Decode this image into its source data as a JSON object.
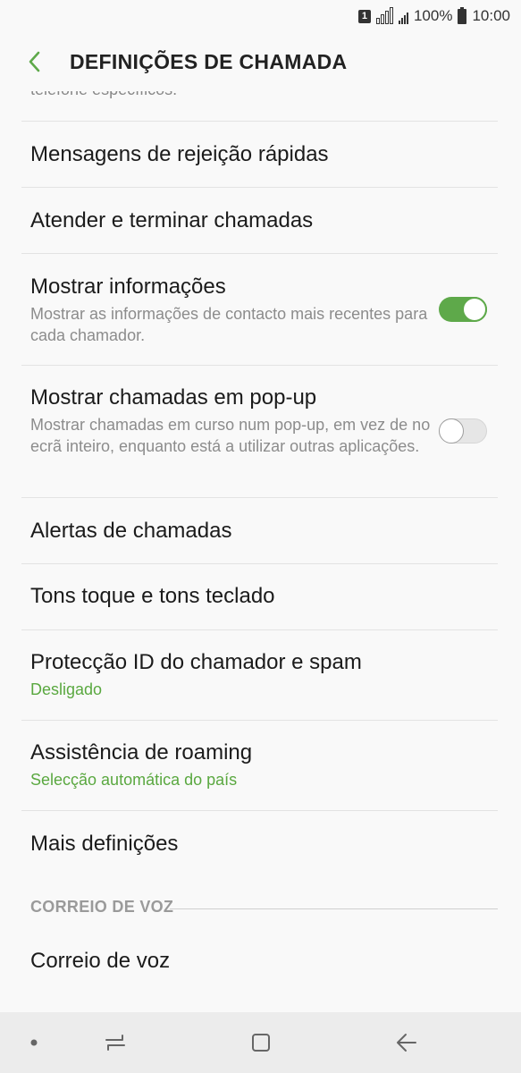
{
  "status": {
    "sim": "1",
    "battery": "100%",
    "time": "10:00"
  },
  "appbar": {
    "title": "DEFINIÇÕES DE CHAMADA"
  },
  "cutoff_text": "telefone específicos.",
  "items": [
    {
      "title": "Mensagens de rejeição rápidas"
    },
    {
      "title": "Atender e terminar chamadas"
    },
    {
      "title": "Mostrar informações",
      "description": "Mostrar as informações de contacto mais recentes para cada chamador.",
      "toggle": "on"
    },
    {
      "title": "Mostrar chamadas em pop-up",
      "description": "Mostrar chamadas em curso num pop-up, em vez de no ecrã inteiro, enquanto está a utilizar outras aplicações.",
      "toggle": "off"
    },
    {
      "title": "Alertas de chamadas"
    },
    {
      "title": "Tons toque e tons teclado"
    },
    {
      "title": "Protecção ID do chamador e spam",
      "subtitle": "Desligado"
    },
    {
      "title": "Assistência de roaming",
      "subtitle": "Selecção automática do país"
    },
    {
      "title": "Mais definições"
    }
  ],
  "section": {
    "label": "CORREIO DE VOZ"
  },
  "voicemail": {
    "title": "Correio de voz"
  },
  "colors": {
    "accent": "#5ea94a",
    "subtitle_green": "#5aa840"
  },
  "nav": {
    "icons": [
      "dot-icon",
      "recents-icon",
      "home-icon",
      "back-icon"
    ]
  }
}
